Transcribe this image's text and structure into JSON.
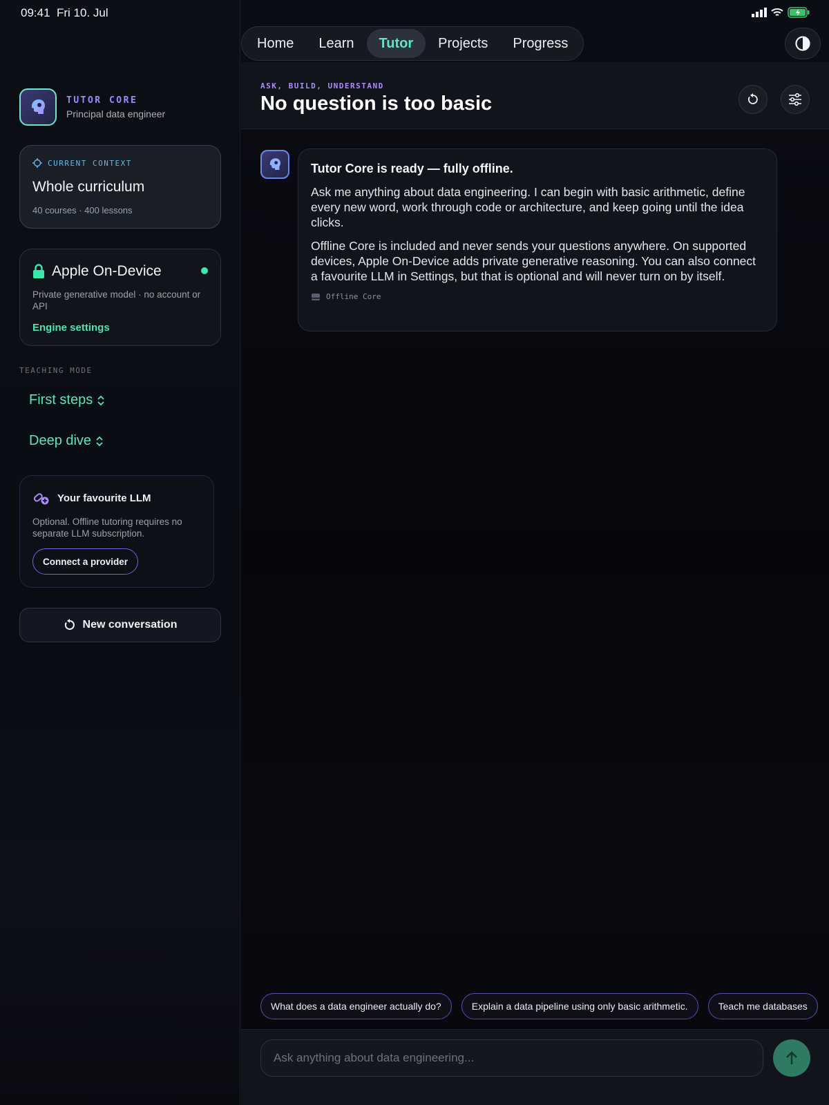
{
  "status": {
    "time": "09:41",
    "date": "Fri 10. Jul"
  },
  "brand": {
    "title": "TUTOR CORE",
    "subtitle": "Principal data engineer"
  },
  "context": {
    "label": "CURRENT CONTEXT",
    "title": "Whole curriculum",
    "meta": "40 courses · 400 lessons"
  },
  "engine": {
    "title": "Apple On-Device",
    "description": "Private generative model · no account or API",
    "link": "Engine settings",
    "status_color": "#3ee6ae"
  },
  "teaching_mode": {
    "label": "TEACHING MODE",
    "level": "First steps",
    "depth": "Deep dive"
  },
  "llm": {
    "title": "Your favourite LLM",
    "description": "Optional. Offline tutoring requires no separate LLM subscription.",
    "button": "Connect a provider"
  },
  "new_conversation": "New conversation",
  "nav": {
    "tabs": [
      "Home",
      "Learn",
      "Tutor",
      "Projects",
      "Progress"
    ],
    "active": "Tutor"
  },
  "header": {
    "eyebrow": "ASK, BUILD, UNDERSTAND",
    "title": "No question is too basic"
  },
  "message": {
    "title": "Tutor Core is ready — fully offline.",
    "paragraphs": [
      "Ask me anything about data engineering. I can begin with basic arithmetic, define every new word, work through code or architecture, and keep going until the idea clicks.",
      "Offline Core is included and never sends your questions anywhere. On supported devices, Apple On-Device adds private generative reasoning. You can also connect a favourite LLM in Settings, but that is optional and will never turn on by itself."
    ],
    "source": "Offline Core"
  },
  "suggestions": [
    "What does a data engineer actually do?",
    "Explain a data pipeline using only basic arithmetic.",
    "Teach me databases"
  ],
  "composer": {
    "placeholder": "Ask anything about data engineering..."
  },
  "colors": {
    "accent": "#5ee6c8",
    "purple": "#9b8cff",
    "send": "#2e7a62"
  }
}
